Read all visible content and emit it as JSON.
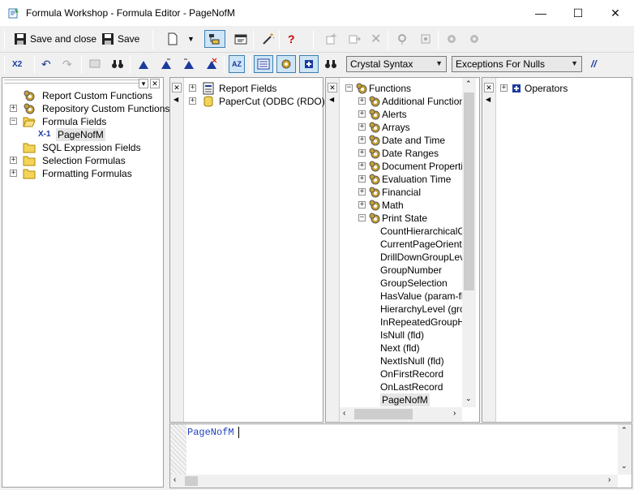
{
  "window": {
    "title": "Formula Workshop - Formula Editor - PageNofM",
    "minimize_glyph": "—",
    "maximize_glyph": "☐",
    "close_glyph": "✕"
  },
  "toolbar1": {
    "save_and_close_label": "Save and close",
    "save_label": "Save",
    "help_glyph": "?"
  },
  "toolbar2": {
    "syntax_select": "Crystal Syntax",
    "nulls_select": "Exceptions For Nulls",
    "comment_glyph": "//",
    "x2_glyph": "X2",
    "sort_glyph": "AZ"
  },
  "workshop_tree": {
    "items": [
      {
        "label": "Report Custom Functions",
        "icon": "gear-icon",
        "expandable": false
      },
      {
        "label": "Repository Custom Functions",
        "icon": "gear-icon",
        "expandable": true
      },
      {
        "label": "Formula Fields",
        "icon": "folder-open-icon",
        "expandable": true,
        "expanded": true
      },
      {
        "label": "PageNofM",
        "icon": "formula-icon",
        "child": true,
        "selected": true
      },
      {
        "label": "SQL Expression Fields",
        "icon": "folder-icon",
        "expandable": false
      },
      {
        "label": "Selection Formulas",
        "icon": "folder-icon",
        "expandable": true
      },
      {
        "label": "Formatting Formulas",
        "icon": "folder-icon",
        "expandable": true
      }
    ],
    "formula_icon_glyph": "X-1"
  },
  "fields_tree": {
    "items": [
      {
        "label": "Report Fields",
        "icon": "report-icon"
      },
      {
        "label": "PaperCut (ODBC (RDO))",
        "icon": "database-icon"
      }
    ]
  },
  "functions_tree": {
    "root": "Functions",
    "groups": [
      "Additional Functions",
      "Alerts",
      "Arrays",
      "Date and Time",
      "Date Ranges",
      "Document Properties",
      "Evaluation Time",
      "Financial",
      "Math",
      "Print State"
    ],
    "print_state_items": [
      "CountHierarchicalChi",
      "CurrentPageOrientati",
      "DrillDownGroupLevel",
      "GroupNumber",
      "GroupSelection",
      "HasValue (param-fld)",
      "HierarchyLevel (group",
      "InRepeatedGroupHe",
      "IsNull (fld)",
      "Next (fld)",
      "NextIsNull (fld)",
      "OnFirstRecord",
      "OnLastRecord",
      "PageNofM"
    ]
  },
  "operators_tree": {
    "root": "Operators"
  },
  "editor": {
    "text": "PageNofM"
  }
}
